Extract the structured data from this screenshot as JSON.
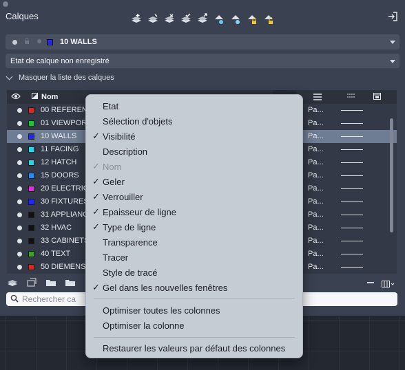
{
  "palette": {
    "title": "Calques",
    "current_layer_name": "10 WALLS",
    "layer_state": "Etat de calque non enregistré",
    "collapse_label": "Masquer la liste des calques",
    "search_placeholder": "Rechercher ca",
    "accent": "#6e7d93"
  },
  "table": {
    "header_nom": "Nom",
    "rows": [
      {
        "name": "00 REFERENCE",
        "color": "#e0261f",
        "pa": "Pa...",
        "selected": false
      },
      {
        "name": "01 VIEWPORT",
        "color": "#1fc33a",
        "pa": "Pa...",
        "selected": false
      },
      {
        "name": "10 WALLS",
        "color": "#2329e8",
        "pa": "Pa...",
        "selected": true
      },
      {
        "name": "11 FACING",
        "color": "#27d6e8",
        "pa": "Pa...",
        "selected": false
      },
      {
        "name": "12 HATCH",
        "color": "#27d6e8",
        "pa": "Pa...",
        "selected": false
      },
      {
        "name": "15 DOORS",
        "color": "#2a8ce8",
        "pa": "Pa...",
        "selected": false
      },
      {
        "name": "20 ELECTRICAL",
        "color": "#e22ce0",
        "pa": "Pa...",
        "selected": false
      },
      {
        "name": "30 FIXTURES",
        "color": "#2329e8",
        "pa": "Pa...",
        "selected": false
      },
      {
        "name": "31 APPLIANCES",
        "color": "#111111",
        "pa": "Pa...",
        "selected": false
      },
      {
        "name": "32 HVAC",
        "color": "#111111",
        "pa": "Pa...",
        "selected": false
      },
      {
        "name": "33 CABINETS",
        "color": "#111111",
        "pa": "Pa...",
        "selected": false
      },
      {
        "name": "40 TEXT",
        "color": "#3fa12c",
        "pa": "Pa...",
        "selected": false
      },
      {
        "name": "50 DIEMENSIONS",
        "color": "#e0261f",
        "pa": "Pa...",
        "selected": false
      }
    ]
  },
  "menu": {
    "items": [
      {
        "label": "Etat",
        "checked": false,
        "disabled": false
      },
      {
        "label": "Sélection d'objets",
        "checked": false,
        "disabled": false
      },
      {
        "label": "Visibilité",
        "checked": true,
        "disabled": false
      },
      {
        "label": "Description",
        "checked": false,
        "disabled": false
      },
      {
        "label": "Nom",
        "checked": true,
        "disabled": true
      },
      {
        "label": "Geler",
        "checked": true,
        "disabled": false
      },
      {
        "label": "Verrouiller",
        "checked": true,
        "disabled": false
      },
      {
        "label": "Epaisseur de ligne",
        "checked": true,
        "disabled": false
      },
      {
        "label": "Type de ligne",
        "checked": true,
        "disabled": false
      },
      {
        "label": "Transparence",
        "checked": false,
        "disabled": false
      },
      {
        "label": "Tracer",
        "checked": false,
        "disabled": false
      },
      {
        "label": "Style de tracé",
        "checked": false,
        "disabled": false
      },
      {
        "label": "Gel dans les nouvelles fenêtres",
        "checked": true,
        "disabled": false
      }
    ],
    "optimize_all": "Optimiser toutes les colonnes",
    "optimize_one": "Optimiser la colonne",
    "restore": "Restaurer les valeurs par défaut des colonnes",
    "check_glyph": "✓"
  }
}
